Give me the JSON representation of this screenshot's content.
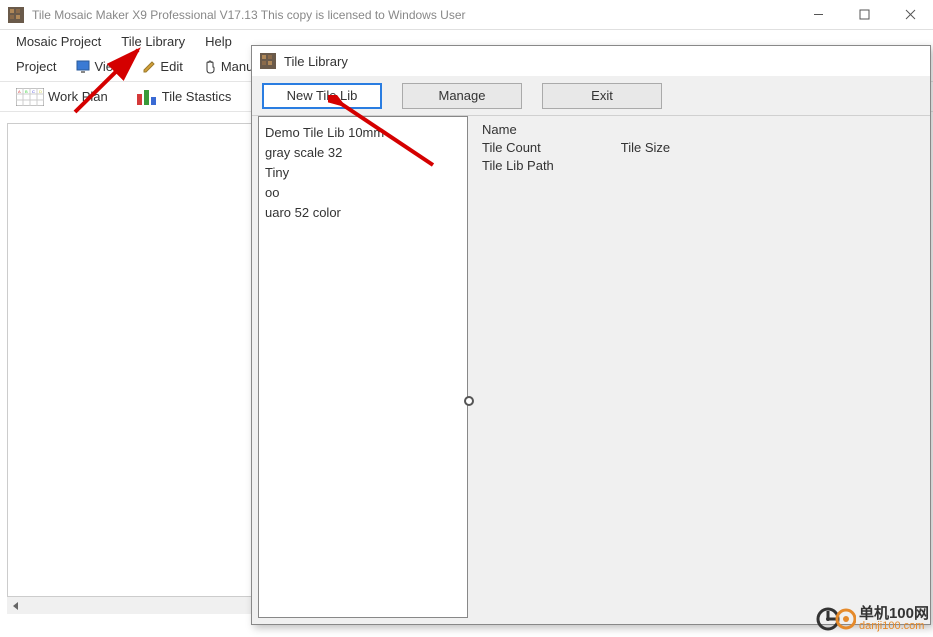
{
  "main_window": {
    "title": "Tile Mosaic Maker X9 Professional V17.13   This copy is licensed to Windows User"
  },
  "menubar": {
    "items": [
      "Mosaic Project",
      "Tile Library",
      "Help"
    ]
  },
  "toolbar": {
    "project": "Project",
    "view": "View",
    "edit": "Edit",
    "manual": "Manua"
  },
  "toolbar2": {
    "work_plan": "Work Plan",
    "tile_stastics": "Tile Stastics"
  },
  "dialog": {
    "title": "Tile Library",
    "buttons": {
      "new": "New Tile Lib",
      "manage": "Manage",
      "exit": "Exit"
    },
    "lib_items": [
      "Demo Tile Lib 10mm",
      "gray scale 32",
      "Tiny",
      "oo",
      "uaro 52 color"
    ],
    "detail": {
      "name_label": "Name",
      "tile_count_label": "Tile Count",
      "tile_size_label": "Tile Size",
      "tile_lib_path_label": "Tile Lib Path"
    }
  },
  "watermark": {
    "text_big": "单机100网",
    "text_small": "danji100.com"
  }
}
